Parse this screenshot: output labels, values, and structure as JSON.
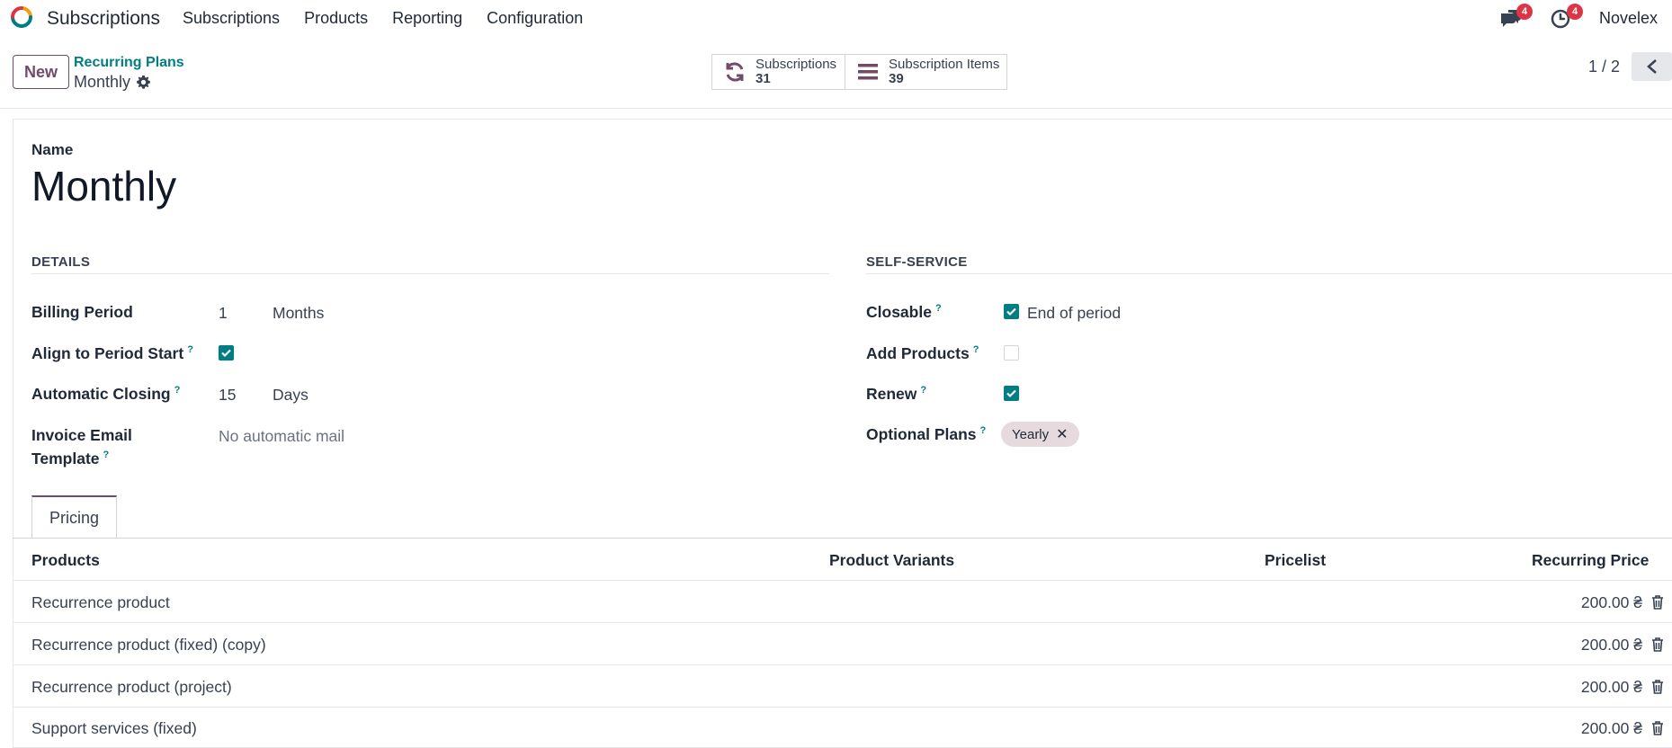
{
  "navbar": {
    "app_name": "Subscriptions",
    "menu": [
      "Subscriptions",
      "Products",
      "Reporting",
      "Configuration"
    ],
    "messages_badge": "4",
    "activities_badge": "4",
    "company": "Novelex"
  },
  "control_panel": {
    "new_label": "New",
    "breadcrumb_parent": "Recurring Plans",
    "record_name": "Monthly",
    "smart_buttons": [
      {
        "label": "Subscriptions",
        "value": "31"
      },
      {
        "label": "Subscription Items",
        "value": "39"
      }
    ],
    "pager": "1 / 2"
  },
  "form": {
    "name_label": "Name",
    "name_value": "Monthly",
    "details": {
      "title": "DETAILS",
      "billing_period_label": "Billing Period",
      "billing_period_value": "1",
      "billing_period_unit": "Months",
      "align_label": "Align to Period Start",
      "align_checked": true,
      "auto_close_label": "Automatic Closing",
      "auto_close_value": "15",
      "auto_close_unit": "Days",
      "invoice_label_1": "Invoice Email",
      "invoice_label_2": "Template",
      "invoice_value": "No automatic mail"
    },
    "self_service": {
      "title": "SELF-SERVICE",
      "closable_label": "Closable",
      "closable_checked": true,
      "closable_value": "End of period",
      "add_products_label": "Add Products",
      "add_products_checked": false,
      "renew_label": "Renew",
      "renew_checked": true,
      "optional_plans_label": "Optional Plans",
      "optional_plans_tag": "Yearly"
    },
    "help_marker": "?"
  },
  "tabs": [
    {
      "label": "Pricing"
    }
  ],
  "pricing_table": {
    "columns": [
      "Products",
      "Product Variants",
      "Pricelist",
      "Recurring Price"
    ],
    "rows": [
      {
        "product": "Recurrence product",
        "price": "200.00 ₴"
      },
      {
        "product": "Recurrence product (fixed) (copy)",
        "price": "200.00 ₴"
      },
      {
        "product": "Recurrence product (project)",
        "price": "200.00 ₴"
      },
      {
        "product": "Support services (fixed)",
        "price": "200.00 ₴"
      }
    ]
  },
  "colors": {
    "primary": "#714b67",
    "accent": "#017e84",
    "badge": "#dc3545"
  }
}
